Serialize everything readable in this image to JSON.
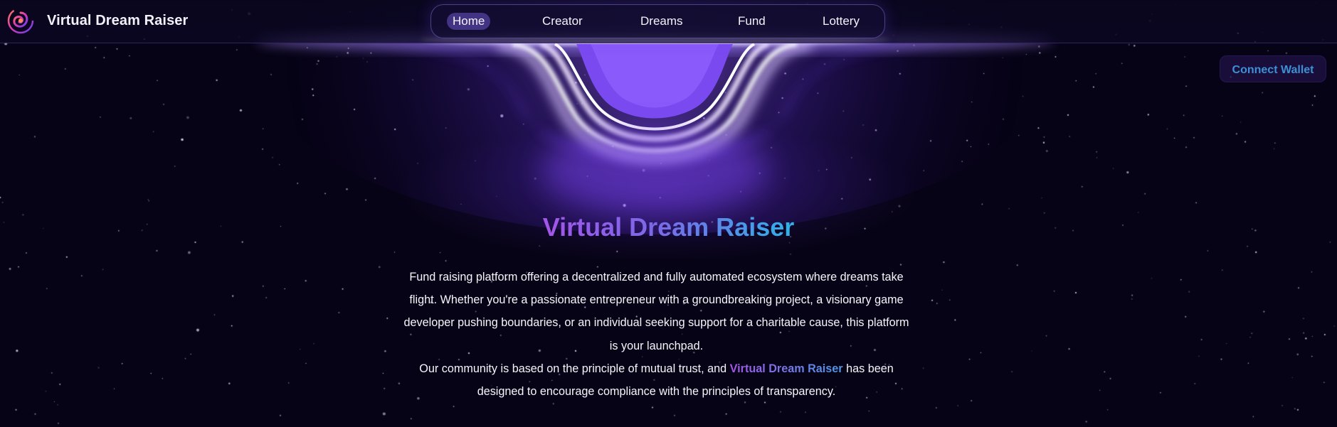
{
  "brand": {
    "name": "Virtual Dream Raiser",
    "logo_icon": "spiral-logo-icon"
  },
  "nav": {
    "items": [
      {
        "label": "Home",
        "active": true
      },
      {
        "label": "Creator",
        "active": false
      },
      {
        "label": "Dreams",
        "active": false
      },
      {
        "label": "Fund",
        "active": false
      },
      {
        "label": "Lottery",
        "active": false
      }
    ]
  },
  "wallet": {
    "connect_label": "Connect Wallet"
  },
  "hero": {
    "title": "Virtual Dream Raiser",
    "paragraph1": "Fund raising platform offering a decentralized and fully automated ecosystem where dreams take flight. Whether you're a passionate entrepreneur with a groundbreaking project, a visionary game developer pushing boundaries, or an individual seeking support for a charitable cause, this platform is your launchpad.",
    "paragraph2_before": "Our community is based on the principle of mutual trust, and ",
    "paragraph2_highlight": "Virtual Dream Raiser",
    "paragraph2_after": " has been designed to encourage compliance with the principles of transparency."
  },
  "colors": {
    "background": "#070316",
    "accent_purple": "#a455e8",
    "accent_blue": "#2fb2e8",
    "connect_text": "#3d8fd6"
  }
}
